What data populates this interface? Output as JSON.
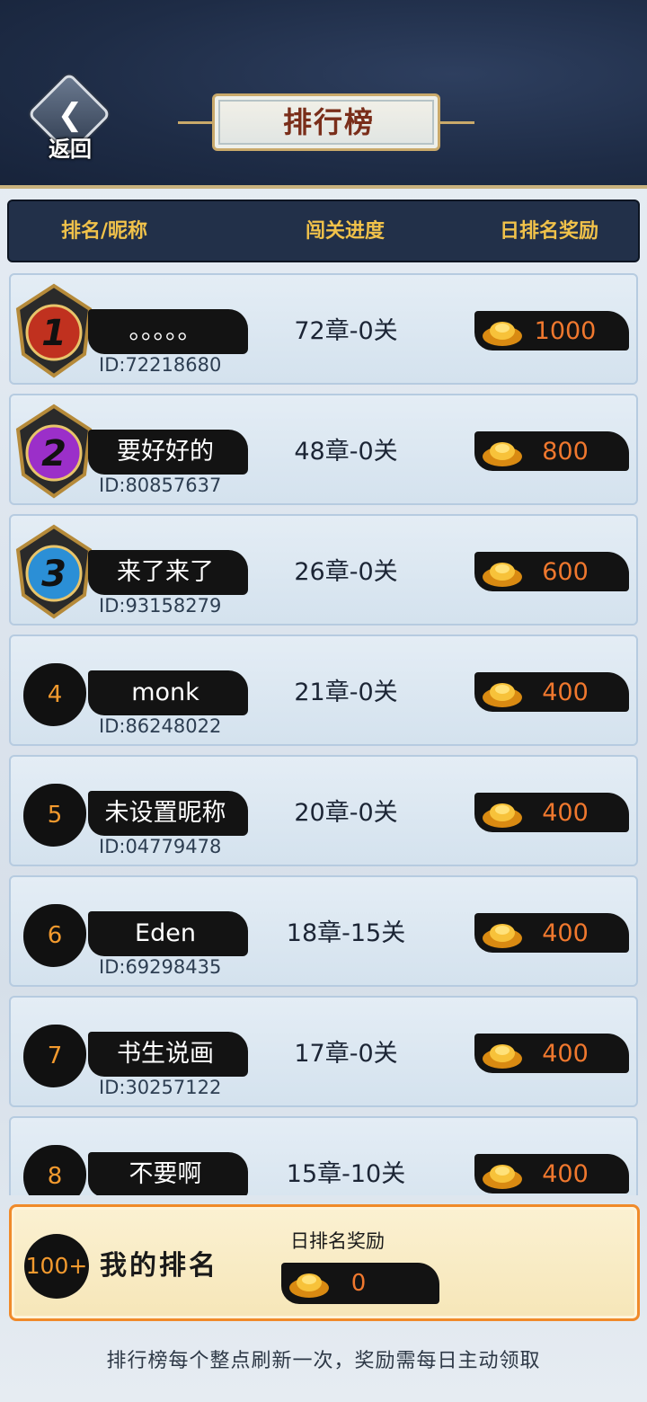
{
  "header": {
    "back_label": "返回",
    "title": "排行榜"
  },
  "columns": {
    "rank_name": "排名/昵称",
    "progress": "闯关进度",
    "reward": "日排名奖励"
  },
  "rows": [
    {
      "rank": "1",
      "name": "。。。。。",
      "id": "ID:72218680",
      "progress": "72章-0关",
      "reward": "1000",
      "badge_color": "#c0311f"
    },
    {
      "rank": "2",
      "name": "要好好的",
      "id": "ID:80857637",
      "progress": "48章-0关",
      "reward": "800",
      "badge_color": "#9b2fc9"
    },
    {
      "rank": "3",
      "name": "来了来了",
      "id": "ID:93158279",
      "progress": "26章-0关",
      "reward": "600",
      "badge_color": "#2b8fd6"
    },
    {
      "rank": "4",
      "name": "monk",
      "id": "ID:86248022",
      "progress": "21章-0关",
      "reward": "400"
    },
    {
      "rank": "5",
      "name": "未设置昵称",
      "id": "ID:04779478",
      "progress": "20章-0关",
      "reward": "400"
    },
    {
      "rank": "6",
      "name": "Eden",
      "id": "ID:69298435",
      "progress": "18章-15关",
      "reward": "400"
    },
    {
      "rank": "7",
      "name": "书生说画",
      "id": "ID:30257122",
      "progress": "17章-0关",
      "reward": "400"
    },
    {
      "rank": "8",
      "name": "不要啊",
      "id": "",
      "progress": "15章-10关",
      "reward": "400"
    }
  ],
  "my_rank": {
    "rank": "100+",
    "label": "我的排名",
    "reward_title": "日排名奖励",
    "reward": "0"
  },
  "footer_note": "排行榜每个整点刷新一次，奖励需每日主动领取",
  "colors": {
    "header_bg": "#1e2c46",
    "accent_gold": "#f1c24a",
    "reward_orange": "#f0782e",
    "rank_orange": "#f39a2e",
    "my_rank_border": "#f08a2a"
  }
}
